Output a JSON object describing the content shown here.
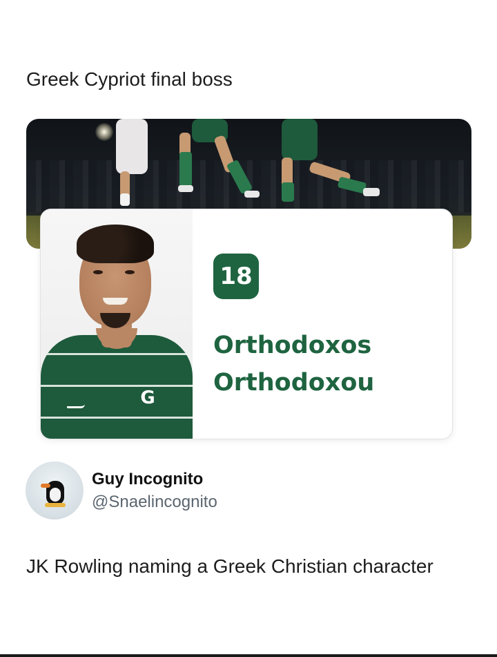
{
  "post": {
    "text": "Greek Cypriot final boss"
  },
  "roster_card": {
    "number": "18",
    "first_name": "Orthodoxos",
    "last_name": "Orthodoxou",
    "accent_color": "#1e6440"
  },
  "quoted_post": {
    "author_name": "Guy Incognito",
    "author_handle": "@Snaelincognito",
    "text": "JK Rowling naming a Greek Christian character"
  }
}
